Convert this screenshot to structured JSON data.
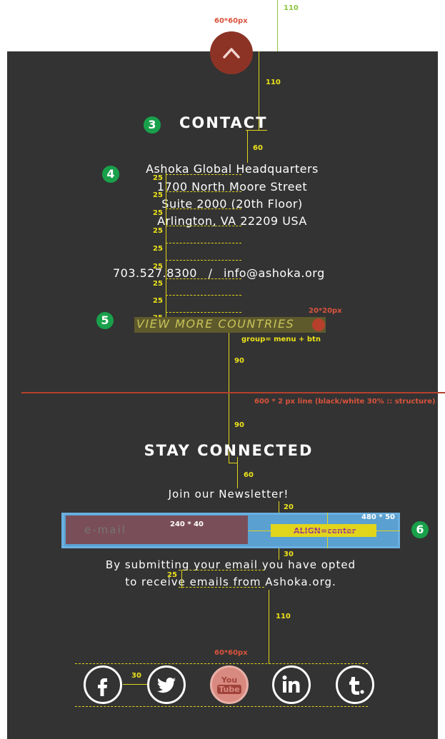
{
  "annotations": {
    "top_button_size": "60*60px",
    "top_offset": "110",
    "contact_offset": "110",
    "title_gap": "60",
    "line_spacing": "25",
    "menu_gap_above_rule": "90",
    "menu_gap_below_rule": "90",
    "dot_size": "20*20px",
    "group_note": "group= menu + btn",
    "rule_note": "600 * 2 px line (black/white 30% :: structure)",
    "heading_gap": "60",
    "input_gap": "20",
    "input_size": "240 * 40",
    "form_size": "480 * 50",
    "align_note": "ALIGN=center",
    "disclaimer_gap": "30",
    "disclaimer_line": "25",
    "social_gap": "110",
    "social_size": "60*60px",
    "icon_gap": "30"
  },
  "badges": [
    "3",
    "4",
    "5",
    "6"
  ],
  "contact": {
    "title": "CONTACT",
    "address": [
      "Ashoka Global Headquarters",
      "1700 North Moore Street",
      "Suite 2000 (20th Floor)",
      "Arlington, VA 22209 USA"
    ],
    "phone": "703.527.8300",
    "separator": "/",
    "email": "info@ashoka.org",
    "more_link": "VIEW MORE COUNTRIES"
  },
  "stay_connected": {
    "title": "STAY CONNECTED",
    "newsletter": "Join our Newsletter!",
    "email_placeholder": "e-mail",
    "disclaimer": [
      "By submitting your email you have opted",
      "to receive emails from Ashoka.org."
    ]
  },
  "social": {
    "icons": [
      "facebook-icon",
      "twitter-icon",
      "youtube-icon",
      "linkedin-icon",
      "tumblr-icon"
    ],
    "youtube_text": [
      "You",
      "Tube"
    ]
  },
  "colors": {
    "background": "#333333",
    "accent_red": "#b6402c",
    "annotation_yellow": "#e1d51c",
    "form_blue": "#6ab0e0",
    "input_fill": "#7a4e58",
    "badge_green": "#19a04b"
  }
}
